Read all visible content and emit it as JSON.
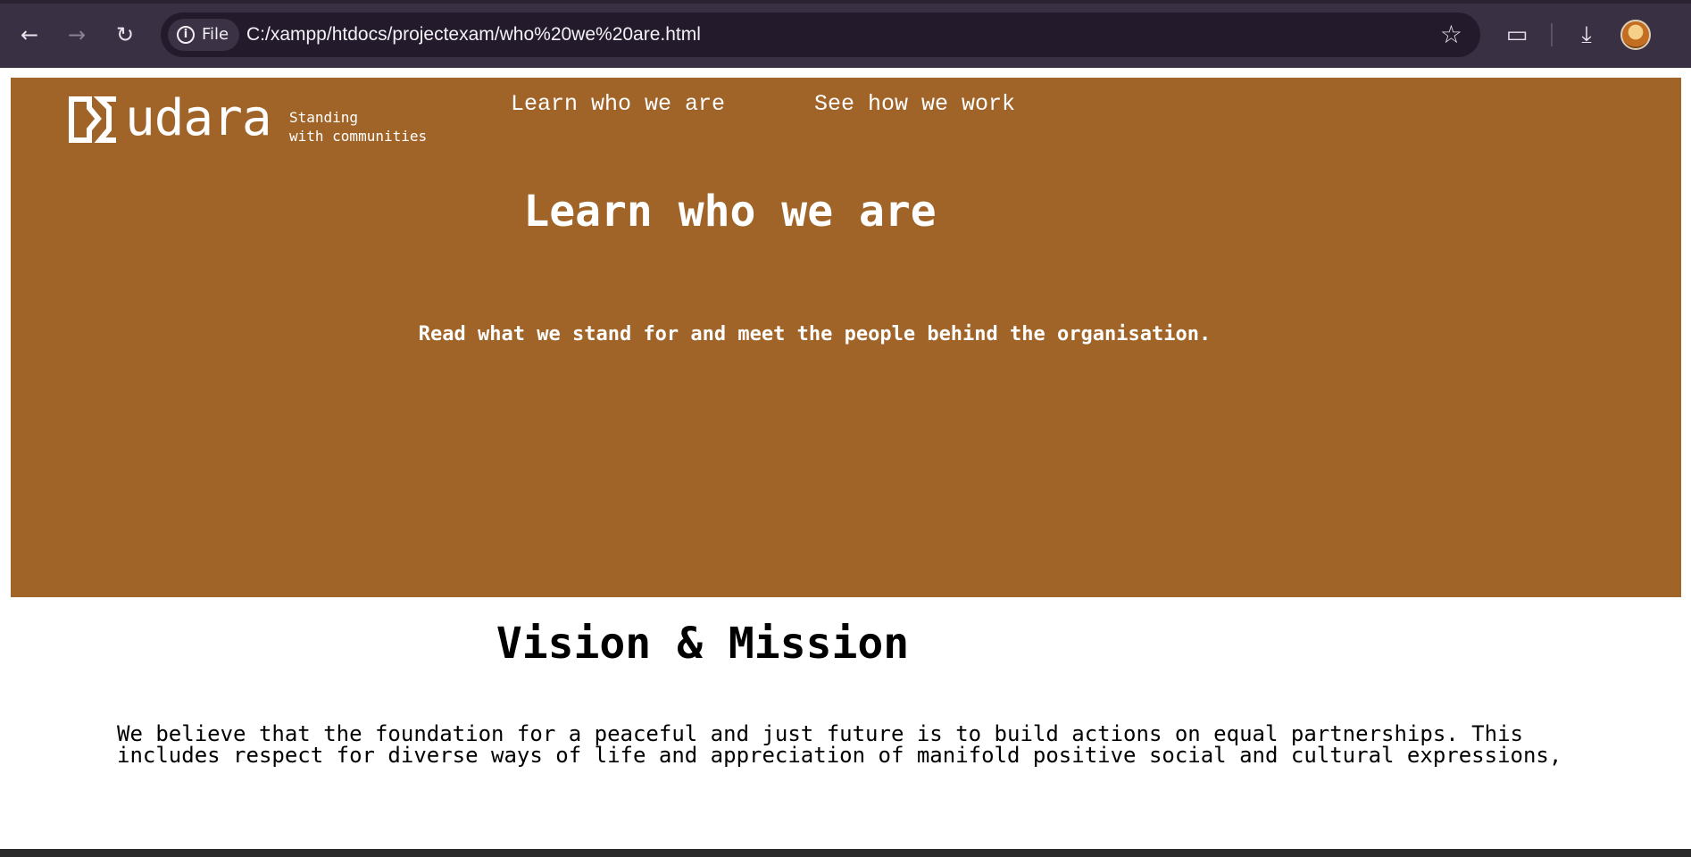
{
  "browser": {
    "chip_label": "File",
    "url": "C:/xampp/htdocs/projectexam/who%20we%20are.html",
    "icons": [
      "back-arrow-icon",
      "forward-arrow-icon",
      "reload-icon",
      "info-icon",
      "star-icon",
      "extensions-icon",
      "download-icon",
      "profile-avatar"
    ]
  },
  "site": {
    "logo_text": "udara",
    "tagline_line1": "Standing",
    "tagline_line2": "with communities",
    "nav": [
      {
        "label": "Learn who we are"
      },
      {
        "label": "See how we work"
      }
    ]
  },
  "hero": {
    "title": "Learn who we are",
    "subtitle": "Read what we stand for and meet the people behind the organisation."
  },
  "section": {
    "title": "Vision & Mission",
    "paragraph_line1": "We believe that the foundation for a peaceful and just future is to build actions on equal partnerships. This",
    "paragraph_line2": "includes respect for diverse ways of life and appreciation of manifold positive social and cultural expressions,"
  },
  "colors": {
    "hero_background": "#a06428",
    "chrome_background": "#3a3043",
    "text_on_hero": "#ffffff"
  }
}
